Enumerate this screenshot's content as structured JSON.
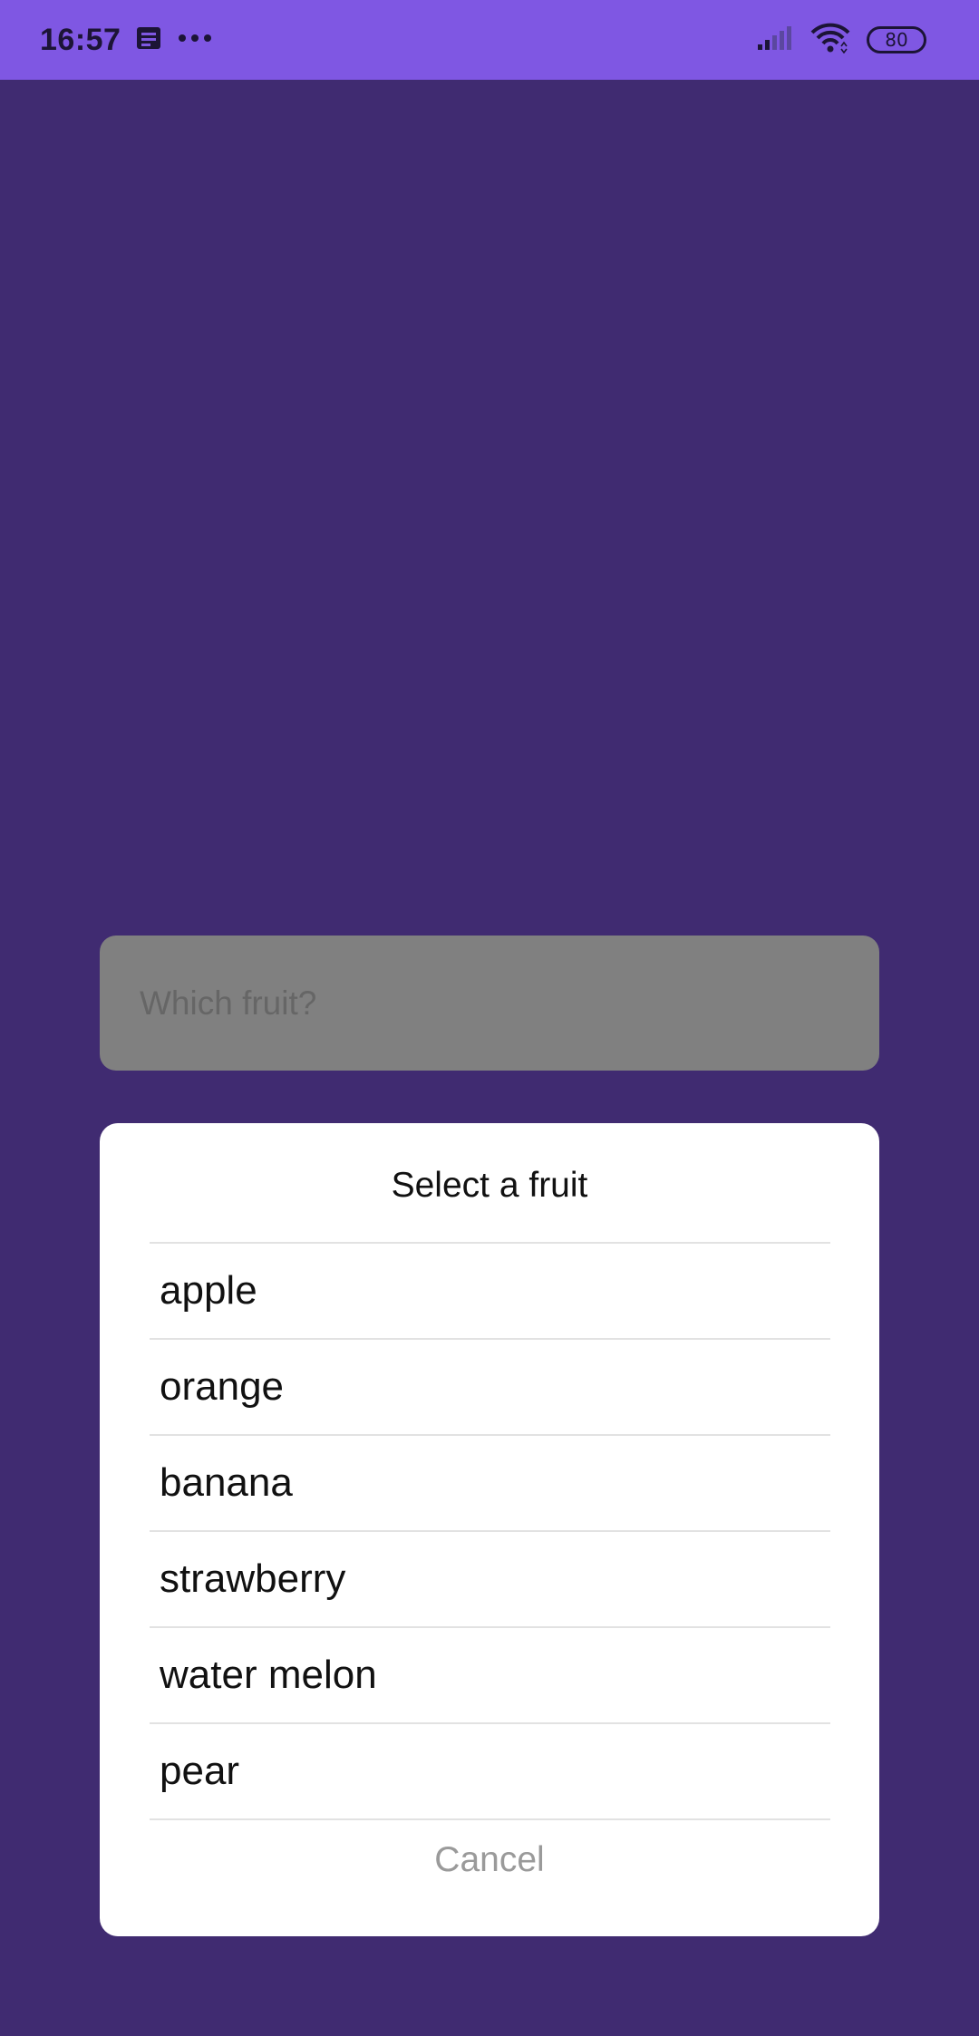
{
  "status_bar": {
    "time": "16:57",
    "notification_icon": "message-icon",
    "more_icon": "more-dots-icon",
    "signal_icon": "signal-icon",
    "wifi_icon": "wifi-icon",
    "battery_level": "80"
  },
  "input": {
    "placeholder": "Which fruit?"
  },
  "dialog": {
    "title": "Select a fruit",
    "items": [
      "apple",
      "orange",
      "banana",
      "strawberry",
      "water melon",
      "pear"
    ],
    "cancel_label": "Cancel"
  },
  "colors": {
    "status_bar_bg": "#7f57e3",
    "background": "#402b71",
    "input_bg": "#808080",
    "dialog_bg": "#ffffff",
    "cancel_text": "#9a9a9a"
  }
}
